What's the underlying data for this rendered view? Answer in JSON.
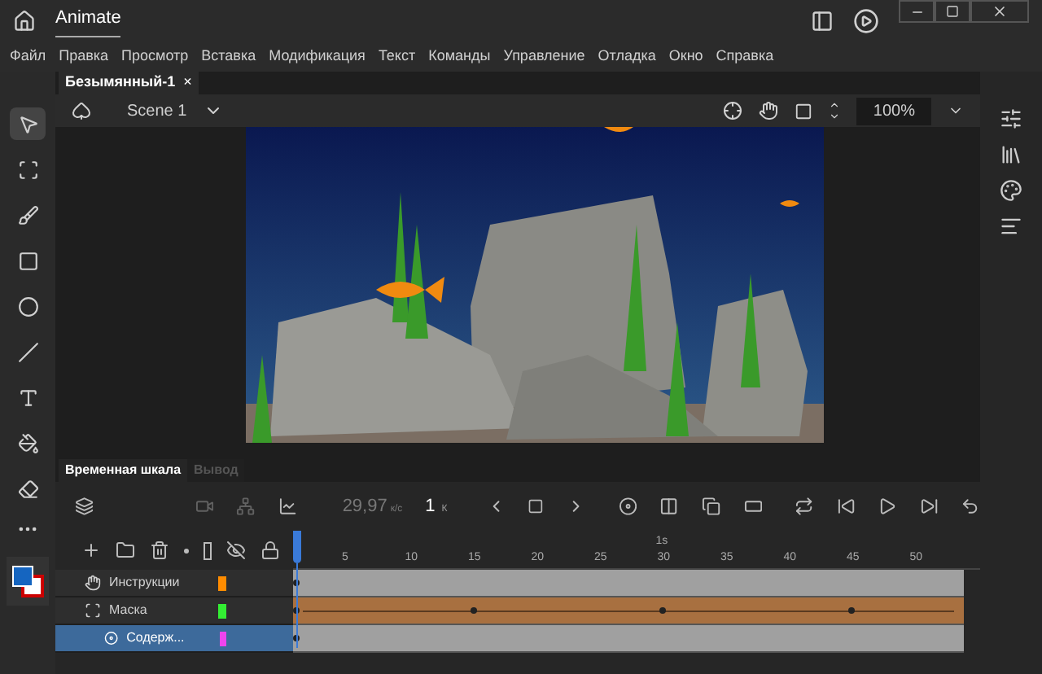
{
  "title_bar": {
    "app_name": "Animate"
  },
  "menu": [
    "Файл",
    "Правка",
    "Просмотр",
    "Вставка",
    "Модификация",
    "Текст",
    "Команды",
    "Управление",
    "Отладка",
    "Окно",
    "Справка"
  ],
  "tools": [
    {
      "kind": "select",
      "selected": true
    },
    {
      "kind": "transform",
      "selected": false
    },
    {
      "kind": "brush",
      "selected": false
    },
    {
      "kind": "rectangle",
      "selected": false
    },
    {
      "kind": "oval",
      "selected": false
    },
    {
      "kind": "line",
      "selected": false
    },
    {
      "kind": "text",
      "selected": false
    },
    {
      "kind": "bucket",
      "selected": false
    },
    {
      "kind": "eraser",
      "selected": false
    }
  ],
  "document_tab": {
    "title": "Безымянный-1",
    "close": "×"
  },
  "scene": {
    "name": "Scene 1"
  },
  "zoom": {
    "value": "100%"
  },
  "timeline": {
    "tabs": [
      {
        "label": "Временная шкала",
        "selected": true
      },
      {
        "label": "Вывод",
        "selected": false
      }
    ],
    "fps": "29,97",
    "fps_unit": "к/с",
    "frame": "1",
    "frame_unit": "К",
    "ruler": [
      "5",
      "10",
      "15",
      "20",
      "25",
      "30",
      "35",
      "40",
      "45",
      "50"
    ],
    "second_marker": "1s",
    "layers": [
      {
        "name": "Инструкции",
        "kind": "guide",
        "color": "#ff8c00",
        "selected": false,
        "tween": false
      },
      {
        "name": "Маска",
        "kind": "mask",
        "color": "#33ee33",
        "selected": false,
        "tween": true
      },
      {
        "name": "Содерж...",
        "kind": "masked",
        "color": "#ee44ee",
        "selected": true,
        "tween": false
      }
    ]
  }
}
